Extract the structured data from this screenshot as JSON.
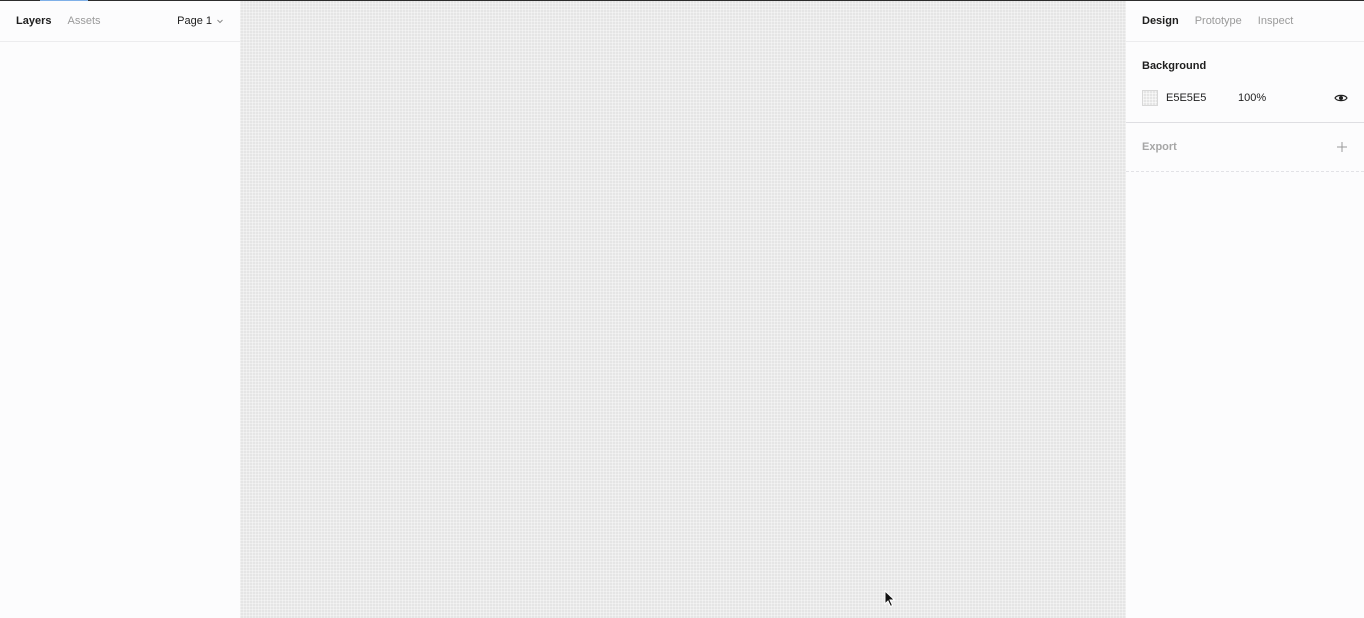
{
  "left_panel": {
    "tabs": [
      {
        "label": "Layers",
        "active": true
      },
      {
        "label": "Assets",
        "active": false
      }
    ],
    "page_select": {
      "label": "Page 1",
      "icon": "chevron-down-icon"
    }
  },
  "canvas": {
    "background_color": "#E5E5E5"
  },
  "right_panel": {
    "tabs": [
      {
        "label": "Design",
        "active": true
      },
      {
        "label": "Prototype",
        "active": false
      },
      {
        "label": "Inspect",
        "active": false
      }
    ],
    "background": {
      "title": "Background",
      "hex": "E5E5E5",
      "opacity": "100%",
      "visibility_icon": "eye-icon"
    },
    "export": {
      "title": "Export",
      "add_icon": "plus-icon"
    }
  },
  "colors": {
    "accent": "#7fb0e8",
    "panel_bg": "#fcfcfd",
    "canvas_bg": "#e5e5e5"
  }
}
